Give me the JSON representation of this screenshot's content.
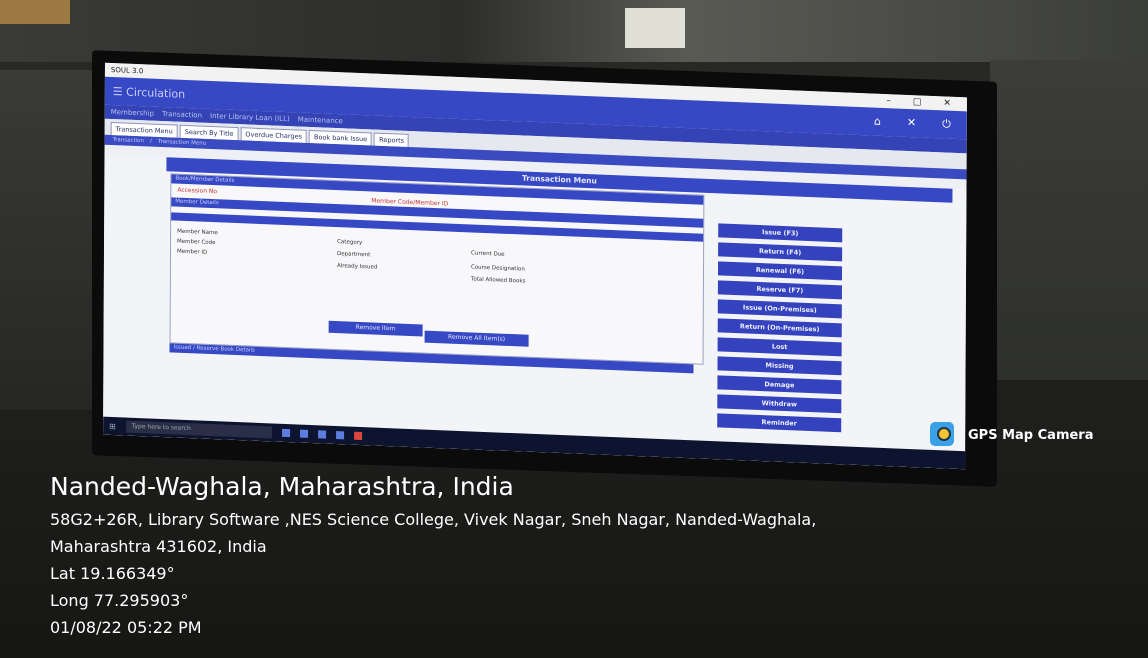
{
  "screen": {
    "window_title": "SOUL 3.0",
    "app_title": "Circulation",
    "menu": [
      "Membership",
      "Transaction",
      "Inter Library Loan (ILL)",
      "Maintenance"
    ],
    "tabs": [
      "Transaction Menu",
      "Search By Title",
      "Overdue Charges",
      "Book bank Issue",
      "Reports"
    ],
    "breadcrumb": [
      "Transaction",
      "Transaction Menu"
    ],
    "section_title": "Transaction Menu",
    "book_member_details": "Book/Member Details",
    "accession_no": "Accession No",
    "member_code_label": "Member Code/Member ID",
    "member_details": "Member Details",
    "fields": {
      "member_name": "Member Name",
      "member_code": "Member Code",
      "member_id": "Member ID",
      "category": "Category",
      "department": "Department",
      "already_issued": "Already Issued",
      "current_due": "Current Due",
      "course_designation": "Course Designation",
      "total_allowed_books": "Total Allowed Books"
    },
    "remove_item": "Remove Item",
    "remove_all": "Remove All Item(s)",
    "issued_reserved": "Issued / Reserve Book Details",
    "actions": [
      "Issue (F3)",
      "Return (F4)",
      "Renewal (F6)",
      "Reserve (F7)",
      "Issue (On-Premises)",
      "Return (On-Premises)",
      "Lost",
      "Missing",
      "Damage",
      "Withdraw",
      "Reminder"
    ],
    "taskbar_search": "Type here to search"
  },
  "overlay": {
    "brand": "GPS Map Camera",
    "place": "Nanded-Waghala, Maharashtra, India",
    "address_line1": "58G2+26R, Library Software ,NES Science College, Vivek Nagar, Sneh Nagar, Nanded-Waghala,",
    "address_line2": "Maharashtra 431602, India",
    "lat": "Lat 19.166349°",
    "long": "Long 77.295903°",
    "datetime": "01/08/22 05:22 PM"
  }
}
